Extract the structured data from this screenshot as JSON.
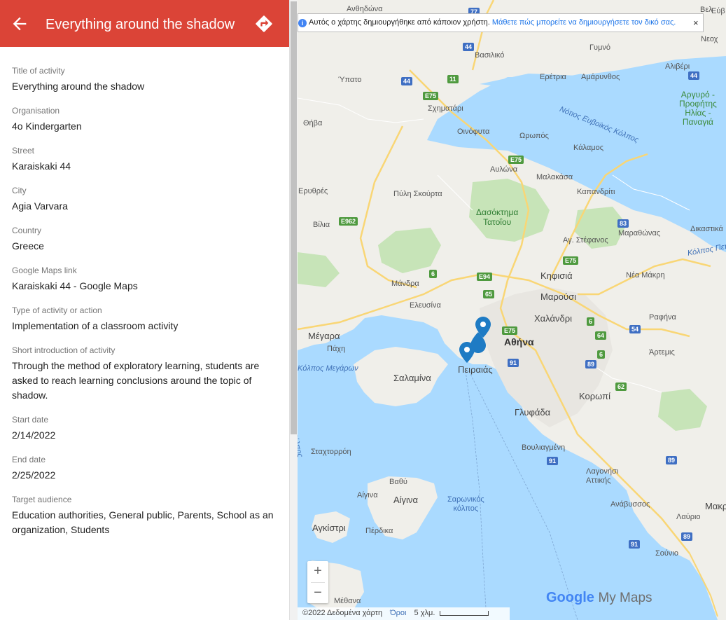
{
  "header": {
    "title": "Everything around the shadow",
    "accent_color": "#db4437",
    "back_icon": "arrow-back-icon",
    "directions_icon": "directions-icon"
  },
  "fields": [
    {
      "label": "Title of activity",
      "value": "Everything around the shadow"
    },
    {
      "label": "Organisation",
      "value": "4o Kindergarten"
    },
    {
      "label": "Street",
      "value": "Karaiskaki 44"
    },
    {
      "label": "City",
      "value": "Agia Varvara"
    },
    {
      "label": "Country",
      "value": "Greece"
    },
    {
      "label": "Google Maps link",
      "value": "Karaiskaki 44 - Google Maps"
    },
    {
      "label": "Type of activity or action",
      "value": "Implementation of a classroom activity"
    },
    {
      "label": "Short introduction of activity",
      "value": "Through the method of exploratory learning, students are asked to reach learning conclusions around the topic of shadow."
    },
    {
      "label": "Start date",
      "value": "2/14/2022"
    },
    {
      "label": "End date",
      "value": "2/25/2022"
    },
    {
      "label": "Target audience",
      "value": "Education authorities, General public, Parents, School as an organization, Students"
    }
  ],
  "map": {
    "notice": {
      "text": "Αυτός ο χάρτης δημιουργήθηκε από κάποιον χρήστη.",
      "link": "Μάθετε πώς μπορείτε να δημιουργήσετε τον δικό σας.",
      "close": "×"
    },
    "zoom_in": "+",
    "zoom_out": "−",
    "brand_google": "Google",
    "brand_mymaps": "My Maps",
    "footer": {
      "copyright": "©2022 Δεδομένα χάρτη",
      "terms": "Όροι",
      "scale": "5 χλμ."
    },
    "labels": {
      "avthona": "Ανθηδώνα",
      "vasiliko": "Βασιλικό",
      "ypato": "Ύπατο",
      "gymno": "Γυμνό",
      "alivei": "Αλιβέρι",
      "neoch": "Νεοχ",
      "eretria": "Ερέτρια",
      "amarynthos": "Αμάρυνθος",
      "argyro": "Αργυρό -\nΠροφήτης\nΗλίας -\nΠαναγιά",
      "notios": "Νότιος Ευβοϊκός Κόλπος",
      "schimatari": "Σχηματάρι",
      "thiva": "Θήβα",
      "oinofyta": "Οινόφυτα",
      "oropos": "Ωρωπός",
      "kalamos": "Κάλαμος",
      "avlona": "Αυλώνα",
      "malakasa": "Μαλακάσα",
      "erythres": "Ερυθρές",
      "fyli": "Πύλη Σκούρτα",
      "kapandriti": "Καπανδρίτι",
      "dasos": "Δασόκτημα\nΤατοΐου",
      "vilia": "Βίλια",
      "marathonas": "Μαραθώνας",
      "dikastika": "Δικαστικά",
      "stefanos": "Αγ. Στέφανος",
      "kolpos_pet": "Κόλπος Πετ",
      "kifisia": "Κηφισιά",
      "nea_makri": "Νέα Μάκρη",
      "mandra": "Μάνδρα",
      "marousi": "Μαρούσι",
      "elefsina": "Ελευσίνα",
      "chalandri": "Χαλάνδρι",
      "rafina": "Ραφήνα",
      "megara": "Μέγαρα",
      "athina": "Αθήνα",
      "pachi": "Πάχη",
      "artemis": "Άρτεμις",
      "megaron": "Κόλπος Μεγάρων",
      "salamina": "Σαλαμίνα",
      "peiraias": "Πειραιάς",
      "koropi": "Κορωπί",
      "glyfada": "Γλυφάδα",
      "stachtoroi": "Σταχτορρόη",
      "vouliagmeni": "Βουλιαγμένη",
      "lagonisi": "Λαγονήσι\nΑττικής",
      "vathy": "Βαθύ",
      "aigina_town": "Αίγινα",
      "aigina": "Αίγινα",
      "saronikos": "Σαρωνικός\nκόλπος",
      "anavyssos": "Ανάβυσσος",
      "agkistri": "Αγκίστρι",
      "perdika": "Πέρδικα",
      "lavrio": "Λαύριο",
      "makr": "Μακρ",
      "sounio": "Σούνιο",
      "methana": "Μέθανα",
      "top_right": "Βελ",
      "top_right2": "Εύβ",
      "korinth": "Κόλπος"
    },
    "shields": {
      "r77": "77",
      "r44a": "44",
      "r44b": "44",
      "r44c": "44",
      "r11": "11",
      "e75a": "E75",
      "e75b": "E75",
      "e75c": "E75",
      "e75d": "E75",
      "e962": "E962",
      "r6a": "6",
      "r6b": "6",
      "r6c": "6",
      "e94": "E94",
      "r65": "65",
      "r64": "64",
      "r83": "83",
      "r54": "54",
      "r91a": "91",
      "r89a": "89",
      "r62": "62",
      "r91b": "91",
      "r89b": "89",
      "r91c": "91",
      "r89c": "89"
    },
    "land_color": "#f0efea",
    "water_color": "#aadaff",
    "park_color": "#c7e4b8",
    "road_color": "#f9d675",
    "pin_color": "#1e7bc4"
  }
}
